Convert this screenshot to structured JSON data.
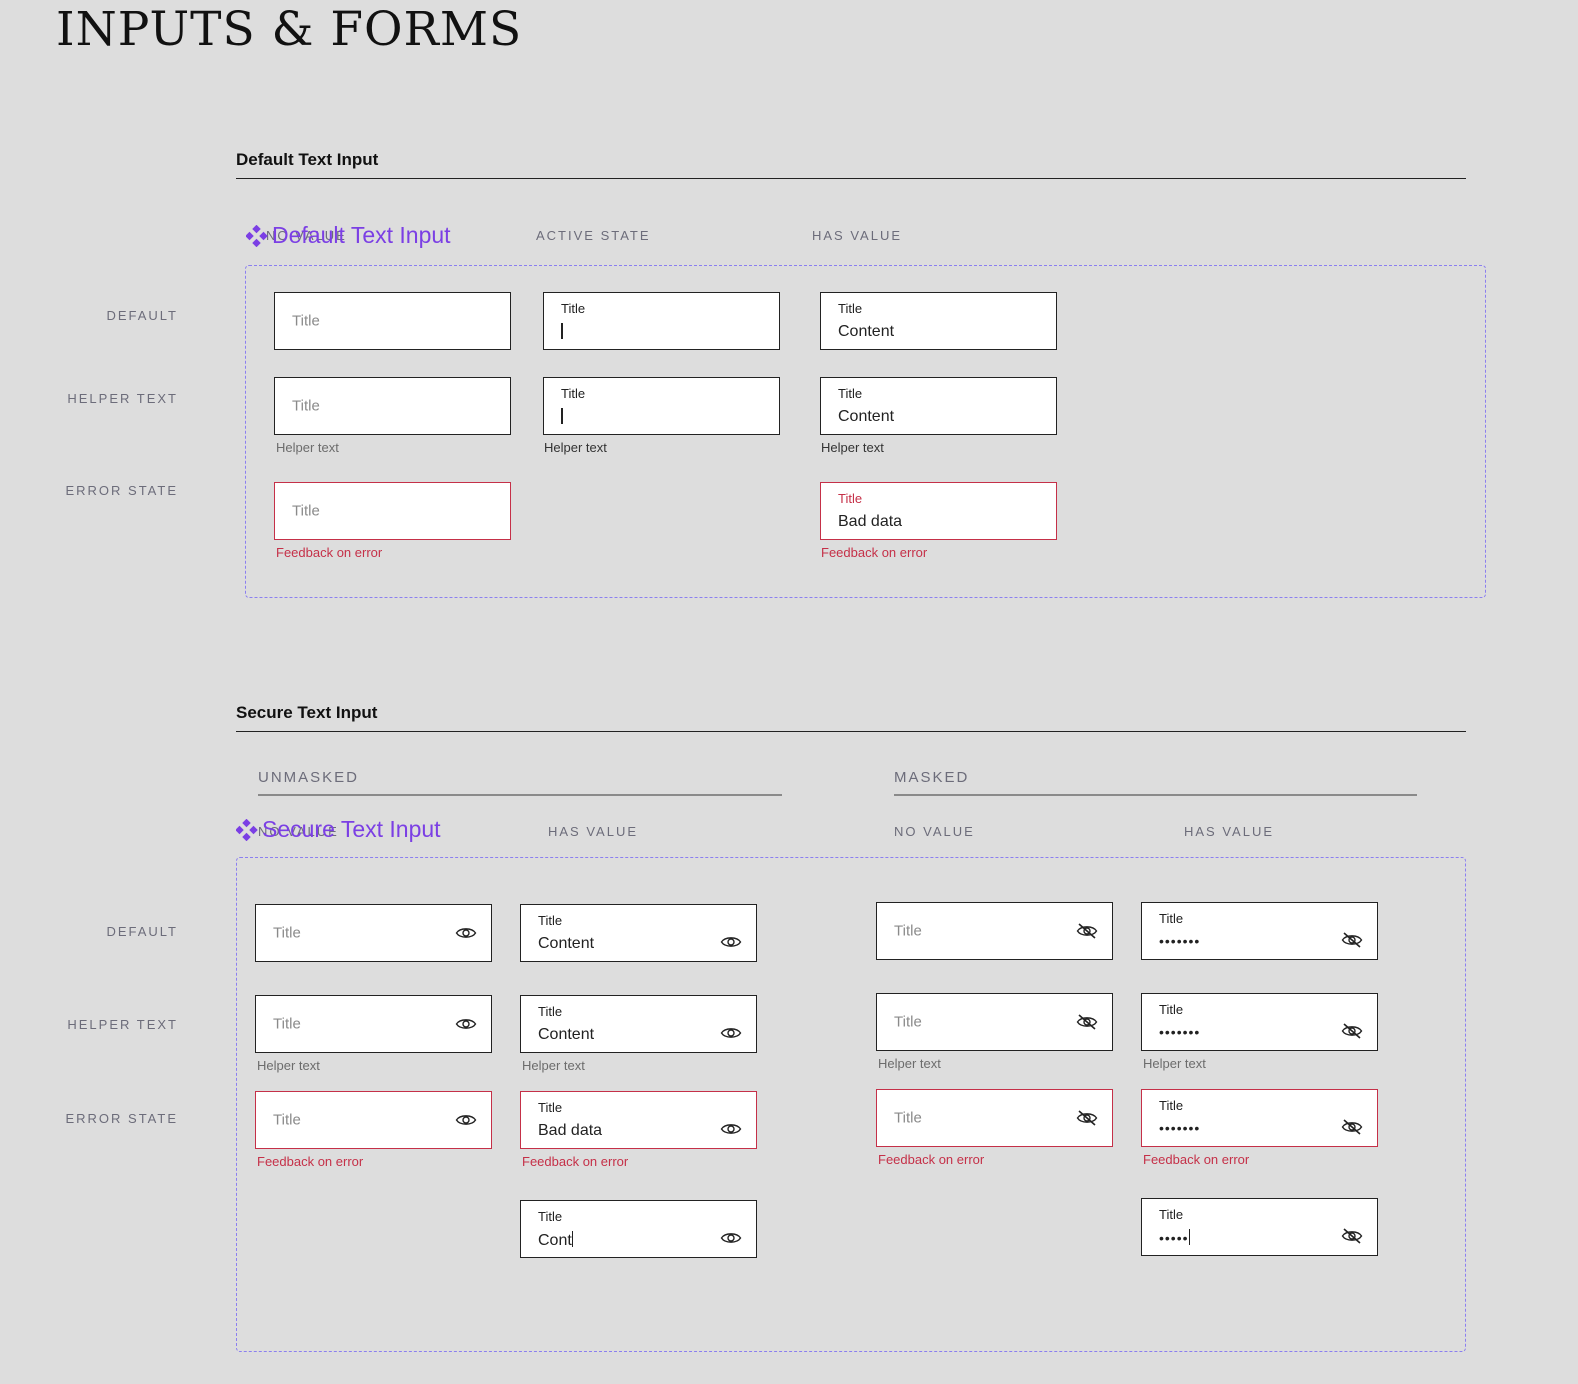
{
  "page": {
    "title": "INPUTS & FORMS"
  },
  "colors": {
    "error": "#c53048",
    "component_label": "#7b3fe4",
    "frame_dash": "#8b7ff0",
    "background": "#dddddd"
  },
  "default_section": {
    "title": "Default Text Input",
    "component_label": "Default Text Input",
    "col_heads": [
      "NO VALUE",
      "ACTIVE STATE",
      "HAS VALUE"
    ],
    "row_labels": [
      "DEFAULT",
      "HELPER TEXT",
      "ERROR STATE"
    ],
    "field_title": "Title",
    "content": "Content",
    "bad_data": "Bad data",
    "helper_text": "Helper text",
    "feedback": "Feedback on error"
  },
  "secure_section": {
    "title": "Secure Text Input",
    "component_label": "Secure Text Input",
    "groups": [
      "UNMASKED",
      "MASKED"
    ],
    "col_heads": [
      "NO VALUE",
      "HAS VALUE",
      "NO VALUE",
      "HAS VALUE"
    ],
    "row_labels": [
      "DEFAULT",
      "HELPER TEXT",
      "ERROR STATE"
    ],
    "field_title": "Title",
    "content": "Content",
    "bad_data": "Bad data",
    "partial": "Cont",
    "masked": "•••••••",
    "masked_partial": "•••••",
    "helper_text": "Helper text",
    "feedback": "Feedback on error",
    "icons": {
      "unmasked": "eye-icon",
      "masked": "eye-off-icon"
    }
  }
}
